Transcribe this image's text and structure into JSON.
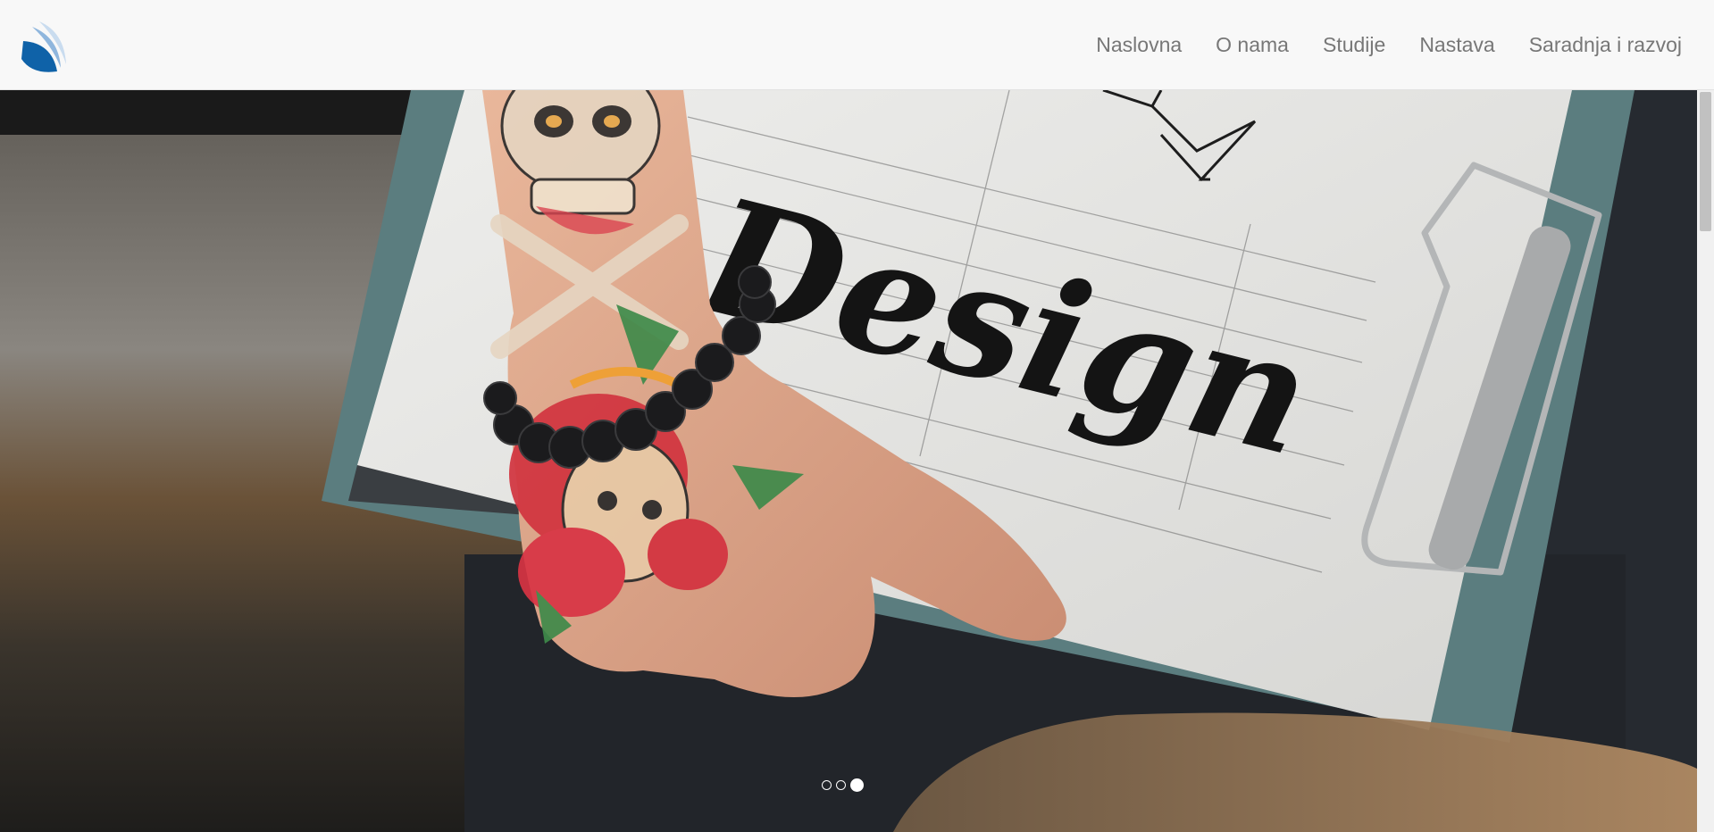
{
  "nav": {
    "items": [
      {
        "label": "Naslovna"
      },
      {
        "label": "O nama"
      },
      {
        "label": "Studije"
      },
      {
        "label": "Nastava"
      },
      {
        "label": "Saradnja i razvoj"
      }
    ]
  },
  "hero": {
    "handwritten_text": "Design",
    "slides_total": 3,
    "active_slide": 3
  },
  "colors": {
    "navbar_bg": "#f8f8f8",
    "nav_text": "#777777",
    "logo_blue": "#0f62a8",
    "logo_light": "#c9dcef"
  }
}
